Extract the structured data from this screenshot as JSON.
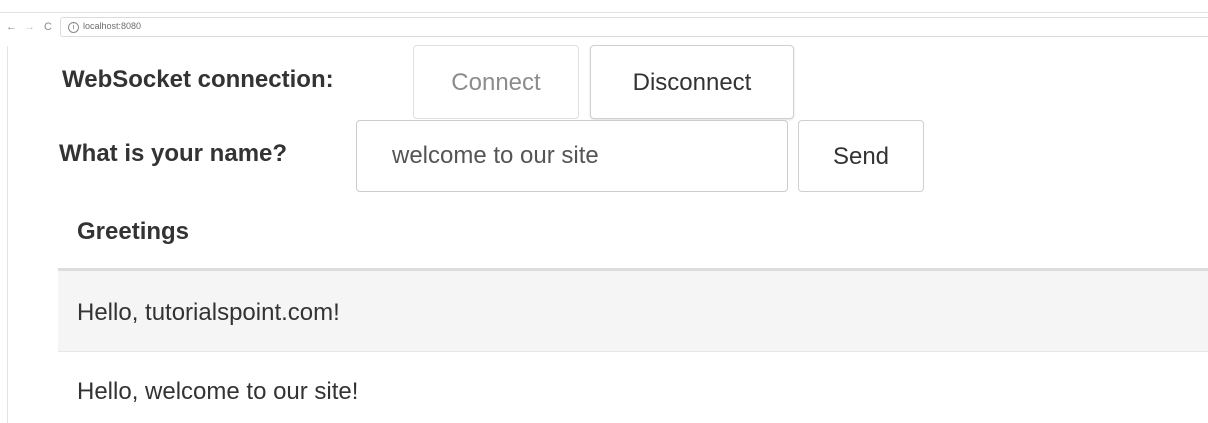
{
  "browser": {
    "back_icon": "←",
    "forward_icon": "→",
    "reload_icon": "C",
    "info_icon": "i",
    "url": "localhost:8080"
  },
  "connection": {
    "label": "WebSocket connection:",
    "connect_label": "Connect",
    "disconnect_label": "Disconnect"
  },
  "form": {
    "name_label": "What is your name?",
    "name_value": "welcome to our site",
    "send_label": "Send"
  },
  "greetings": {
    "header": "Greetings",
    "rows": [
      "Hello, tutorialspoint.com!",
      "Hello, welcome to our site!"
    ]
  },
  "colors": {
    "stripe": "#f5f5f5",
    "border": "#dddddd",
    "text": "#333333"
  }
}
